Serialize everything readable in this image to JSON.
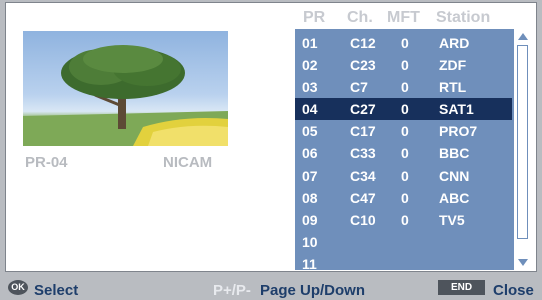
{
  "header": {
    "pr": "PR",
    "ch": "Ch.",
    "mft": "MFT",
    "station": "Station"
  },
  "preview": {
    "program": "PR-04",
    "audio": "NICAM"
  },
  "channels": [
    {
      "pr": "01",
      "ch": "C12",
      "mft": "0",
      "station": "ARD"
    },
    {
      "pr": "02",
      "ch": "C23",
      "mft": "0",
      "station": "ZDF"
    },
    {
      "pr": "03",
      "ch": "C7",
      "mft": "0",
      "station": "RTL"
    },
    {
      "pr": "04",
      "ch": "C27",
      "mft": "0",
      "station": "SAT1"
    },
    {
      "pr": "05",
      "ch": "C17",
      "mft": "0",
      "station": "PRO7"
    },
    {
      "pr": "06",
      "ch": "C33",
      "mft": "0",
      "station": "BBC"
    },
    {
      "pr": "07",
      "ch": "C34",
      "mft": "0",
      "station": "CNN"
    },
    {
      "pr": "08",
      "ch": "C47",
      "mft": "0",
      "station": "ABC"
    },
    {
      "pr": "09",
      "ch": "C10",
      "mft": "0",
      "station": "TV5"
    },
    {
      "pr": "10",
      "ch": "",
      "mft": "",
      "station": ""
    },
    {
      "pr": "11",
      "ch": "",
      "mft": "",
      "station": ""
    }
  ],
  "selected_pr": "04",
  "footer": {
    "ok_icon": "OK",
    "select": "Select",
    "page_key": "P+/P-",
    "page_label": "Page Up/Down",
    "end_icon": "END",
    "close": "Close"
  },
  "colors": {
    "list_bg": "#6f8fbb",
    "selected_row": "#17305c",
    "footer_text": "#1e3e6b"
  }
}
